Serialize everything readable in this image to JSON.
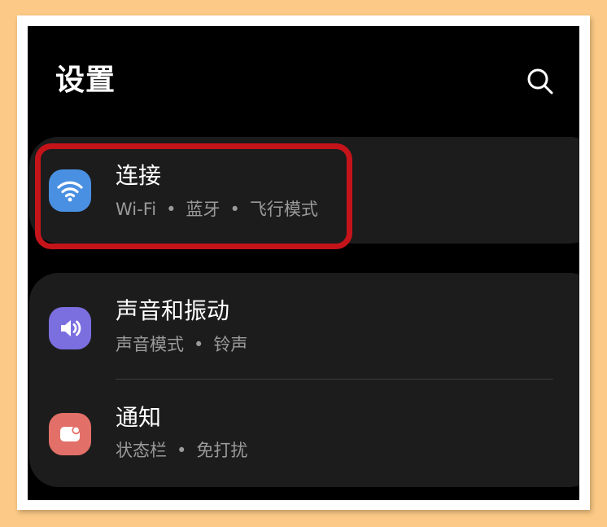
{
  "header": {
    "title": "设置",
    "search_icon": "search-icon"
  },
  "settings": [
    {
      "label": "连接",
      "subtitle_parts": [
        "Wi-Fi",
        "蓝牙",
        "飞行模式"
      ],
      "icon": "wifi-icon",
      "icon_color": "#4a90e2",
      "highlighted": true
    },
    {
      "label": "声音和振动",
      "subtitle_parts": [
        "声音模式",
        "铃声"
      ],
      "icon": "volume-icon",
      "icon_color": "#7b6fe0"
    },
    {
      "label": "通知",
      "subtitle_parts": [
        "状态栏",
        "免打扰"
      ],
      "icon": "notification-icon",
      "icon_color": "#e27068"
    }
  ],
  "separator": "•",
  "colors": {
    "background": "#fcca86",
    "screen": "#000000",
    "card": "#1c1c1c",
    "highlight_border": "#c4141a"
  }
}
